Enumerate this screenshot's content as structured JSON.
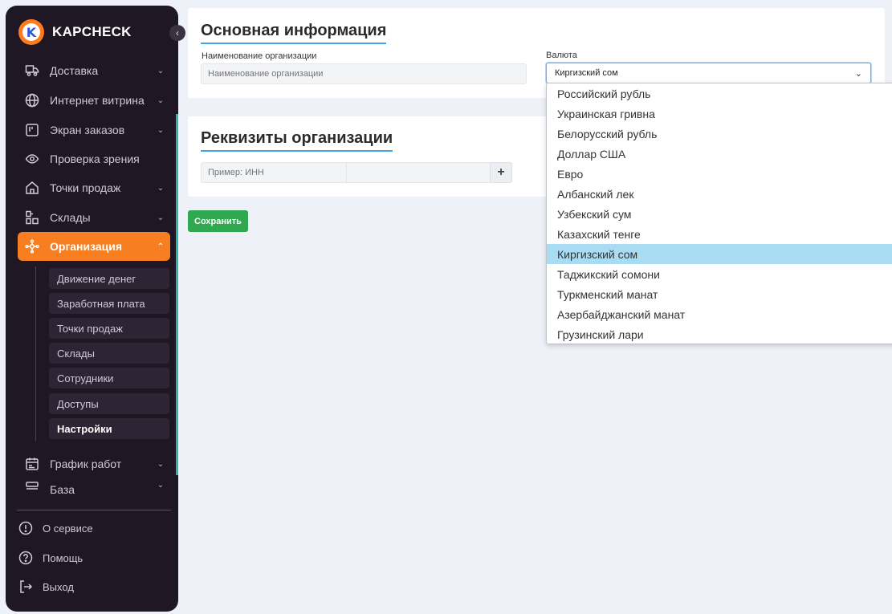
{
  "brand": {
    "name": "KAPCHECK",
    "logo_letter": "K",
    "logo_color": "#ff7a1a"
  },
  "sidebar": {
    "collapse_icon": "chevron-left-icon",
    "items": [
      {
        "label": "Доставка",
        "icon": "truck-icon",
        "has_chevron": true
      },
      {
        "label": "Интернет витрина",
        "icon": "globe-icon",
        "has_chevron": true
      },
      {
        "label": "Экран заказов",
        "icon": "kanban-icon",
        "has_chevron": true
      },
      {
        "label": "Проверка зрения",
        "icon": "eye-icon",
        "has_chevron": false
      },
      {
        "label": "Точки продаж",
        "icon": "home-icon",
        "has_chevron": true
      },
      {
        "label": "Склады",
        "icon": "boxes-icon",
        "has_chevron": true
      },
      {
        "label": "Организация",
        "icon": "organization-icon",
        "has_chevron": true,
        "active": true
      },
      {
        "label": "График работ",
        "icon": "calendar-icon",
        "has_chevron": true
      },
      {
        "label": "База",
        "icon": "database-icon",
        "has_chevron": true
      }
    ],
    "sub_items": [
      {
        "label": "Движение денег"
      },
      {
        "label": "Заработная плата"
      },
      {
        "label": "Точки продаж"
      },
      {
        "label": "Склады"
      },
      {
        "label": "Сотрудники"
      },
      {
        "label": "Доступы"
      },
      {
        "label": "Настройки",
        "current": true
      }
    ],
    "footer": [
      {
        "label": "О сервисе",
        "icon": "info-icon"
      },
      {
        "label": "Помощь",
        "icon": "help-icon"
      },
      {
        "label": "Выход",
        "icon": "logout-icon"
      }
    ],
    "active_color": "#f77f22",
    "accent_color": "#2bb6b0"
  },
  "main_info": {
    "title": "Основная информация",
    "org_name_label": "Наименование организации",
    "org_name_placeholder": "Наименование организации",
    "currency_label": "Валюта",
    "currency_value": "Киргизский сом"
  },
  "requisites": {
    "title": "Реквизиты организации",
    "field_placeholder": "Пример: ИНН",
    "value_placeholder": "",
    "add_label": "+"
  },
  "save_label": "Сохранить",
  "currency_options": [
    "Российский рубль",
    "Украинская гривна",
    "Белорусский рубль",
    "Доллар США",
    "Евро",
    "Албанский лек",
    "Узбекский сум",
    "Казахский тенге",
    "Киргизский сом",
    "Таджикский сомони",
    "Туркменский манат",
    "Азербайджанский манат",
    "Грузинский лари"
  ],
  "selected_currency_index": 8,
  "colors": {
    "save_button": "#2fa84f",
    "title_underline": "#3ea6e6",
    "selected_option": "#a9dcf3"
  }
}
